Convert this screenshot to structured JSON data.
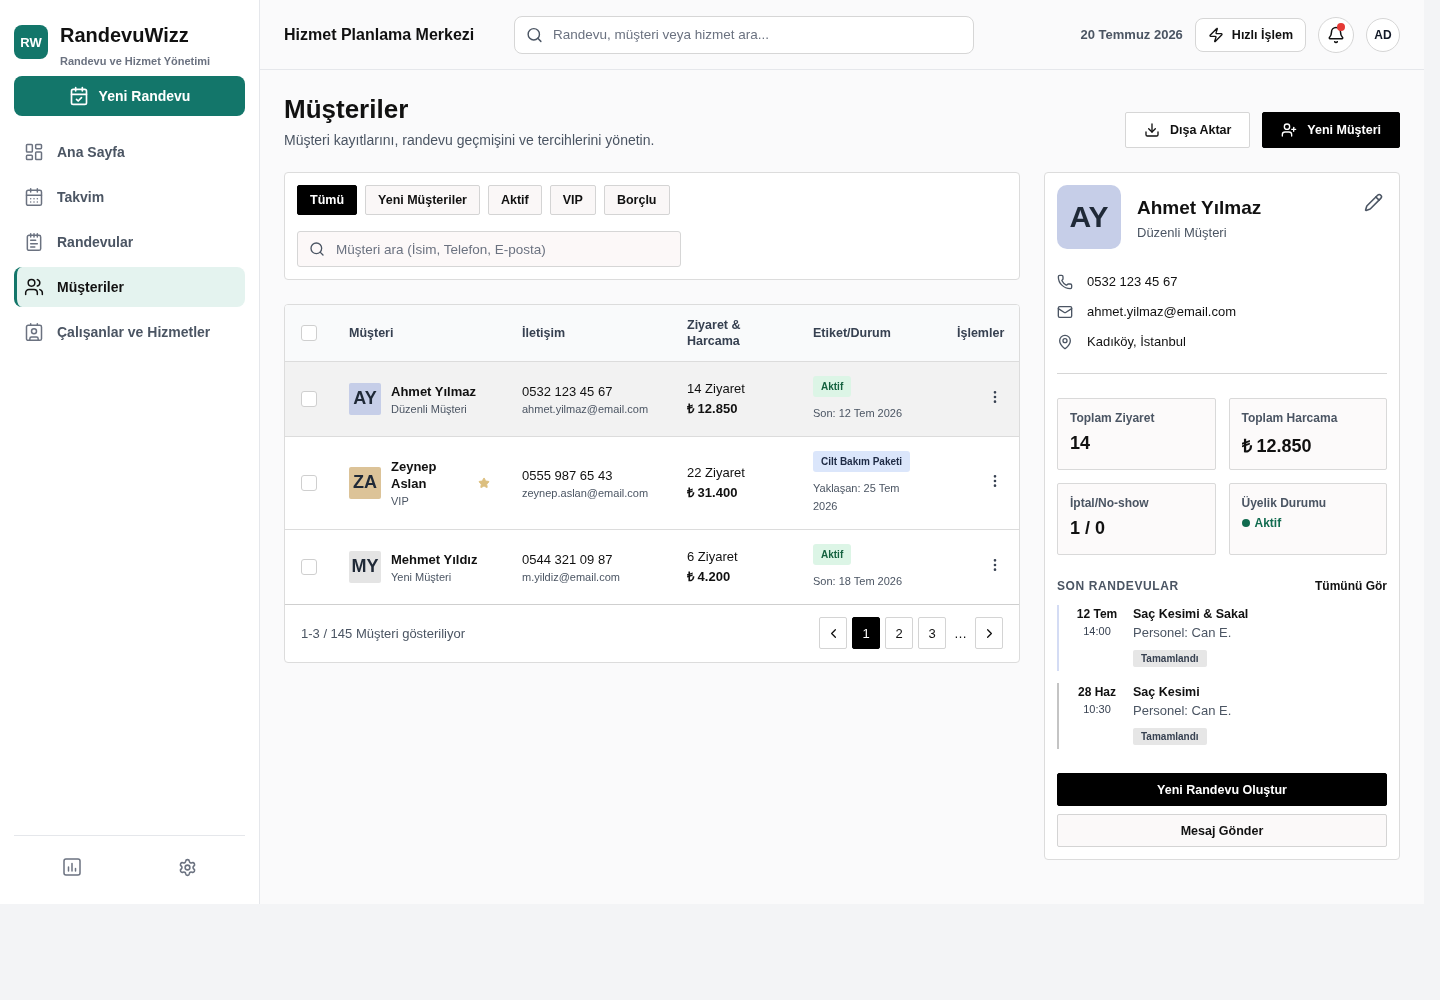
{
  "sidebar": {
    "logo": "RW",
    "app_name": "RandevuWizz",
    "tagline": "Randevu ve Hizmet Yönetimi",
    "new_appointment_button": "Yeni Randevu",
    "nav": [
      {
        "label": "Ana Sayfa",
        "selected": false
      },
      {
        "label": "Takvim",
        "selected": false
      },
      {
        "label": "Randevular",
        "selected": false
      },
      {
        "label": "Müşteriler",
        "selected": true
      },
      {
        "label": "Çalışanlar ve Hizmetler",
        "selected": false
      }
    ]
  },
  "header": {
    "title": "Hizmet Planlama Merkezi",
    "search": {
      "placeholder": "Randevu, müşteri veya hizmet ara..."
    },
    "date": "20 Temmuz 2026",
    "quick_action": "Hızlı İşlem",
    "notifications": {
      "unread": true
    },
    "user_initials": "AD"
  },
  "page": {
    "title": "Müşteriler",
    "subtitle": "Müşteri kayıtlarını, randevu geçmişini ve tercihlerini yönetin.",
    "actions": [
      {
        "label": "Dışa Aktar",
        "kind": "export"
      },
      {
        "label": "Yeni Müşteri",
        "kind": "add"
      }
    ]
  },
  "filters": {
    "chips": [
      {
        "label": "Tümü",
        "selected": true
      },
      {
        "label": "Yeni Müşteriler",
        "selected": false
      },
      {
        "label": "Aktif",
        "selected": false
      },
      {
        "label": "VIP",
        "selected": false
      },
      {
        "label": "Borçlu",
        "selected": false
      }
    ],
    "search": {
      "placeholder": "Müşteri ara (İsim, Telefon, E-posta)"
    }
  },
  "table": {
    "select_all": {
      "checked": false
    },
    "columns": [
      "Müşteri",
      "İletişim",
      "Ziyaret & Harcama",
      "Etiket/Durum",
      "İşlemler"
    ],
    "rows": [
      {
        "selected": true,
        "checked": false,
        "initials": "AY",
        "color": "#c6cee8",
        "name": "Ahmet Yılmaz",
        "segment": "Düzenli Müşteri",
        "starred": false,
        "phone": "0532 123 45 67",
        "email": "ahmet.yilmaz@email.com",
        "visits": "14 Ziyaret",
        "spend": "₺ 12.850",
        "tag": {
          "label": "Aktif",
          "kind": "status"
        },
        "note": "Son: 12 Tem 2026"
      },
      {
        "selected": false,
        "checked": false,
        "initials": "ZA",
        "color": "#dcc398",
        "name": "Zeynep Aslan",
        "segment": "VIP",
        "starred": true,
        "phone": "0555 987 65 43",
        "email": "zeynep.aslan@email.com",
        "visits": "22 Ziyaret",
        "spend": "₺ 31.400",
        "tag": {
          "label": "Cilt Bakım Paketi",
          "kind": "package"
        },
        "note": "Yaklaşan: 25 Tem 2026"
      },
      {
        "selected": false,
        "checked": false,
        "initials": "MY",
        "color": "#e4e4e4",
        "name": "Mehmet Yıldız",
        "segment": "Yeni Müşteri",
        "starred": false,
        "phone": "0544 321 09 87",
        "email": "m.yildiz@email.com",
        "visits": "6 Ziyaret",
        "spend": "₺ 4.200",
        "tag": {
          "label": "Aktif",
          "kind": "status"
        },
        "note": "Son: 18 Tem 2026"
      }
    ],
    "summary": "1-3 / 145 Müşteri gösteriliyor",
    "pages": [
      {
        "label": "1",
        "selected": true
      },
      {
        "label": "2",
        "selected": false
      },
      {
        "label": "3",
        "selected": false
      }
    ],
    "ellipsis": "…"
  },
  "detail": {
    "initials": "AY",
    "color": "#c6cee8",
    "name": "Ahmet Yılmaz",
    "segment": "Düzenli Müşteri",
    "contacts": [
      {
        "kind": "phone",
        "value": "0532 123 45 67"
      },
      {
        "kind": "email",
        "value": "ahmet.yilmaz@email.com"
      },
      {
        "kind": "address",
        "value": "Kadıköy, İstanbul"
      }
    ],
    "stats": [
      {
        "kind": "number",
        "label": "Toplam Ziyaret",
        "value": "14"
      },
      {
        "kind": "number",
        "label": "Toplam Harcama",
        "value": "₺ 12.850"
      },
      {
        "kind": "number",
        "label": "İptal/No-show",
        "value": "1 / 0"
      },
      {
        "kind": "status",
        "label": "Üyelik Durumu",
        "value": "Aktif",
        "color": "#116b4f"
      }
    ],
    "recent_title": "SON RANDEVULAR",
    "see_all": "Tümünü Gör",
    "appointments": [
      {
        "date": "12 Tem",
        "time": "14:00",
        "service": "Saç Kesimi & Sakal",
        "staff": "Personel: Can E.",
        "status": "Tamamlandı",
        "color": "#d4dcf4"
      },
      {
        "date": "28 Haz",
        "time": "10:30",
        "service": "Saç Kesimi",
        "staff": "Personel: Can E.",
        "status": "Tamamlandı",
        "color": "#c4c4c4"
      }
    ],
    "buttons": [
      {
        "label": "Yeni Randevu Oluştur",
        "kind": "primary"
      },
      {
        "label": "Mesaj Gönder",
        "kind": "secondary"
      }
    ]
  }
}
